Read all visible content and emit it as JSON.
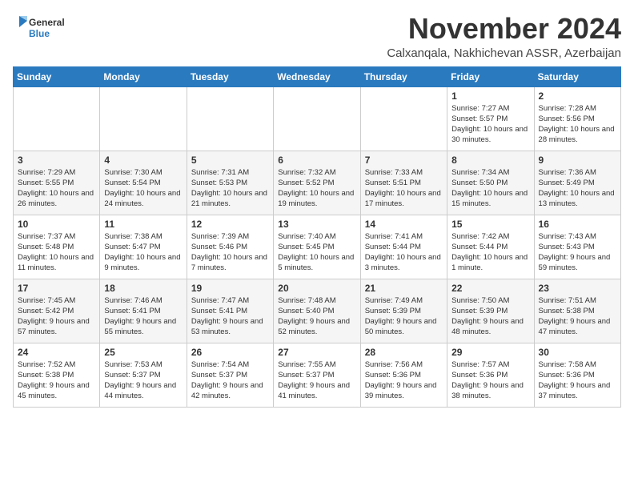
{
  "logo": {
    "general": "General",
    "blue": "Blue"
  },
  "title": "November 2024",
  "subtitle": "Calxanqala, Nakhichevan ASSR, Azerbaijan",
  "headers": [
    "Sunday",
    "Monday",
    "Tuesday",
    "Wednesday",
    "Thursday",
    "Friday",
    "Saturday"
  ],
  "rows": [
    [
      {
        "day": "",
        "content": ""
      },
      {
        "day": "",
        "content": ""
      },
      {
        "day": "",
        "content": ""
      },
      {
        "day": "",
        "content": ""
      },
      {
        "day": "",
        "content": ""
      },
      {
        "day": "1",
        "content": "Sunrise: 7:27 AM\nSunset: 5:57 PM\nDaylight: 10 hours and 30 minutes."
      },
      {
        "day": "2",
        "content": "Sunrise: 7:28 AM\nSunset: 5:56 PM\nDaylight: 10 hours and 28 minutes."
      }
    ],
    [
      {
        "day": "3",
        "content": "Sunrise: 7:29 AM\nSunset: 5:55 PM\nDaylight: 10 hours and 26 minutes."
      },
      {
        "day": "4",
        "content": "Sunrise: 7:30 AM\nSunset: 5:54 PM\nDaylight: 10 hours and 24 minutes."
      },
      {
        "day": "5",
        "content": "Sunrise: 7:31 AM\nSunset: 5:53 PM\nDaylight: 10 hours and 21 minutes."
      },
      {
        "day": "6",
        "content": "Sunrise: 7:32 AM\nSunset: 5:52 PM\nDaylight: 10 hours and 19 minutes."
      },
      {
        "day": "7",
        "content": "Sunrise: 7:33 AM\nSunset: 5:51 PM\nDaylight: 10 hours and 17 minutes."
      },
      {
        "day": "8",
        "content": "Sunrise: 7:34 AM\nSunset: 5:50 PM\nDaylight: 10 hours and 15 minutes."
      },
      {
        "day": "9",
        "content": "Sunrise: 7:36 AM\nSunset: 5:49 PM\nDaylight: 10 hours and 13 minutes."
      }
    ],
    [
      {
        "day": "10",
        "content": "Sunrise: 7:37 AM\nSunset: 5:48 PM\nDaylight: 10 hours and 11 minutes."
      },
      {
        "day": "11",
        "content": "Sunrise: 7:38 AM\nSunset: 5:47 PM\nDaylight: 10 hours and 9 minutes."
      },
      {
        "day": "12",
        "content": "Sunrise: 7:39 AM\nSunset: 5:46 PM\nDaylight: 10 hours and 7 minutes."
      },
      {
        "day": "13",
        "content": "Sunrise: 7:40 AM\nSunset: 5:45 PM\nDaylight: 10 hours and 5 minutes."
      },
      {
        "day": "14",
        "content": "Sunrise: 7:41 AM\nSunset: 5:44 PM\nDaylight: 10 hours and 3 minutes."
      },
      {
        "day": "15",
        "content": "Sunrise: 7:42 AM\nSunset: 5:44 PM\nDaylight: 10 hours and 1 minute."
      },
      {
        "day": "16",
        "content": "Sunrise: 7:43 AM\nSunset: 5:43 PM\nDaylight: 9 hours and 59 minutes."
      }
    ],
    [
      {
        "day": "17",
        "content": "Sunrise: 7:45 AM\nSunset: 5:42 PM\nDaylight: 9 hours and 57 minutes."
      },
      {
        "day": "18",
        "content": "Sunrise: 7:46 AM\nSunset: 5:41 PM\nDaylight: 9 hours and 55 minutes."
      },
      {
        "day": "19",
        "content": "Sunrise: 7:47 AM\nSunset: 5:41 PM\nDaylight: 9 hours and 53 minutes."
      },
      {
        "day": "20",
        "content": "Sunrise: 7:48 AM\nSunset: 5:40 PM\nDaylight: 9 hours and 52 minutes."
      },
      {
        "day": "21",
        "content": "Sunrise: 7:49 AM\nSunset: 5:39 PM\nDaylight: 9 hours and 50 minutes."
      },
      {
        "day": "22",
        "content": "Sunrise: 7:50 AM\nSunset: 5:39 PM\nDaylight: 9 hours and 48 minutes."
      },
      {
        "day": "23",
        "content": "Sunrise: 7:51 AM\nSunset: 5:38 PM\nDaylight: 9 hours and 47 minutes."
      }
    ],
    [
      {
        "day": "24",
        "content": "Sunrise: 7:52 AM\nSunset: 5:38 PM\nDaylight: 9 hours and 45 minutes."
      },
      {
        "day": "25",
        "content": "Sunrise: 7:53 AM\nSunset: 5:37 PM\nDaylight: 9 hours and 44 minutes."
      },
      {
        "day": "26",
        "content": "Sunrise: 7:54 AM\nSunset: 5:37 PM\nDaylight: 9 hours and 42 minutes."
      },
      {
        "day": "27",
        "content": "Sunrise: 7:55 AM\nSunset: 5:37 PM\nDaylight: 9 hours and 41 minutes."
      },
      {
        "day": "28",
        "content": "Sunrise: 7:56 AM\nSunset: 5:36 PM\nDaylight: 9 hours and 39 minutes."
      },
      {
        "day": "29",
        "content": "Sunrise: 7:57 AM\nSunset: 5:36 PM\nDaylight: 9 hours and 38 minutes."
      },
      {
        "day": "30",
        "content": "Sunrise: 7:58 AM\nSunset: 5:36 PM\nDaylight: 9 hours and 37 minutes."
      }
    ]
  ]
}
